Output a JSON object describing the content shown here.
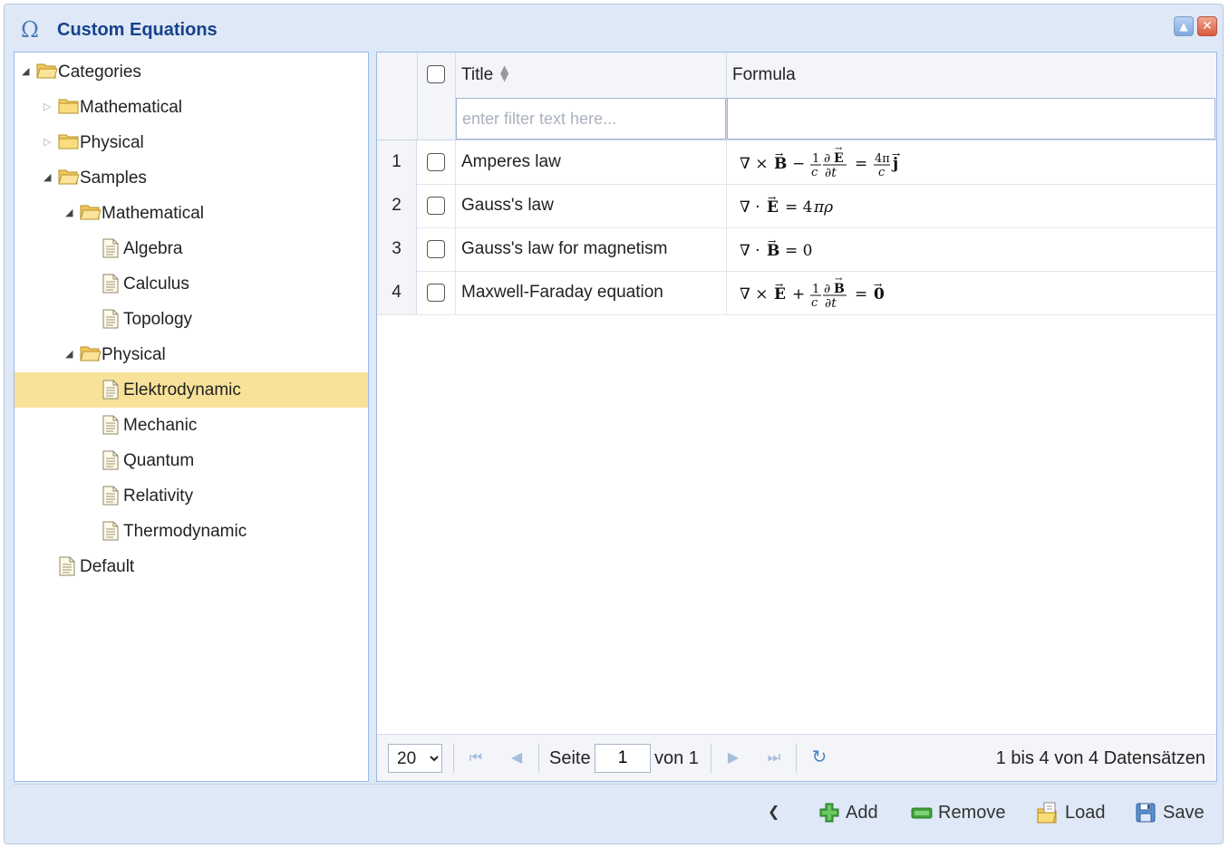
{
  "window": {
    "title": "Custom Equations",
    "title_icon": "omega-icon",
    "collapse_glyph": "▲",
    "close_glyph": "✕"
  },
  "tree": {
    "nodes": [
      {
        "label": "Categories",
        "type": "folder",
        "expanded": true,
        "level": 0
      },
      {
        "label": "Mathematical",
        "type": "folder",
        "expanded": false,
        "level": 1
      },
      {
        "label": "Physical",
        "type": "folder",
        "expanded": false,
        "level": 1
      },
      {
        "label": "Samples",
        "type": "folder",
        "expanded": true,
        "level": 1
      },
      {
        "label": "Mathematical",
        "type": "folder",
        "expanded": true,
        "level": 2
      },
      {
        "label": "Algebra",
        "type": "leaf",
        "level": 3
      },
      {
        "label": "Calculus",
        "type": "leaf",
        "level": 3
      },
      {
        "label": "Topology",
        "type": "leaf",
        "level": 3
      },
      {
        "label": "Physical",
        "type": "folder",
        "expanded": true,
        "level": 2
      },
      {
        "label": "Elektrodynamic",
        "type": "leaf",
        "level": 3,
        "selected": true
      },
      {
        "label": "Mechanic",
        "type": "leaf",
        "level": 3
      },
      {
        "label": "Quantum",
        "type": "leaf",
        "level": 3
      },
      {
        "label": "Relativity",
        "type": "leaf",
        "level": 3
      },
      {
        "label": "Thermodynamic",
        "type": "leaf",
        "level": 3
      },
      {
        "label": "Default",
        "type": "leaf",
        "level": 1
      }
    ]
  },
  "grid": {
    "columns": {
      "title": "Title",
      "formula": "Formula"
    },
    "filter": {
      "title_placeholder": "enter filter text here...",
      "title_value": "",
      "formula_value": ""
    },
    "rows": [
      {
        "num": "1",
        "title": "Amperes law",
        "formula": "∇ × B⃗ − (1/c) ∂E⃗/∂t = (4π/c) j⃗"
      },
      {
        "num": "2",
        "title": "Gauss's law",
        "formula": "∇ · E⃗ = 4πρ"
      },
      {
        "num": "3",
        "title": "Gauss's law for magnetism",
        "formula": "∇ · B⃗ = 0"
      },
      {
        "num": "4",
        "title": "Maxwell-Faraday equation",
        "formula": "∇ × E⃗ + (1/c) ∂B⃗/∂t = 0⃗"
      }
    ]
  },
  "paging": {
    "page_size": "20",
    "page_size_options": [
      "20"
    ],
    "page_label": "Seite",
    "page_value": "1",
    "of_label": "von 1",
    "info": "1 bis 4 von 4 Datensätzen"
  },
  "footer": {
    "chevron": "❮",
    "add_label": "Add",
    "remove_label": "Remove",
    "load_label": "Load",
    "save_label": "Save"
  },
  "colors": {
    "accent": "#15428b",
    "selected_row": "#f8e29a",
    "panel_border": "#99bbe8",
    "window_bg": "#dfe8f6"
  }
}
